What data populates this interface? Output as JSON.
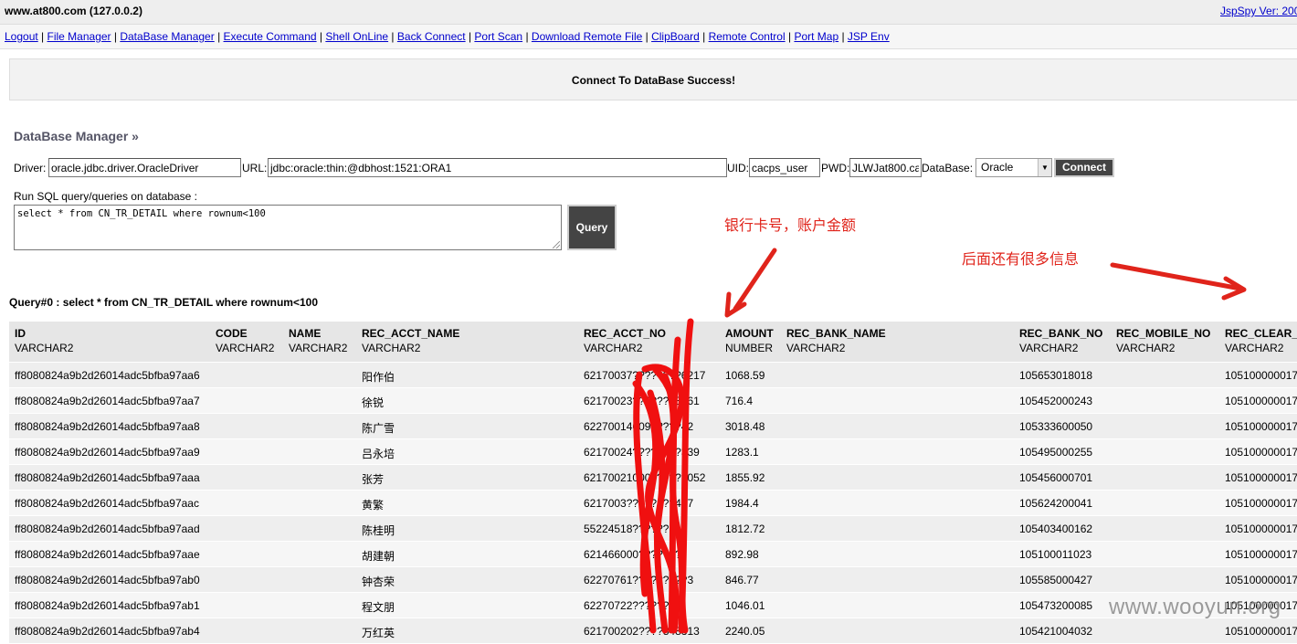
{
  "header": {
    "host": "www.at800.com (127.0.0.2)",
    "version": "JspSpy Ver: 200"
  },
  "nav": [
    "Logout",
    "File Manager",
    "DataBase Manager",
    "Execute Command",
    "Shell OnLine",
    "Back Connect",
    "Port Scan",
    "Download Remote File",
    "ClipBoard",
    "Remote Control",
    "Port Map",
    "JSP Env"
  ],
  "banner": {
    "message": "Connect To DataBase Success!"
  },
  "section_title": "DataBase Manager »",
  "form": {
    "driver_label": "Driver:",
    "driver_value": "oracle.jdbc.driver.OracleDriver",
    "url_label": "URL:",
    "url_value": "jdbc:oracle:thin:@dbhost:1521:ORA1",
    "uid_label": "UID:",
    "uid_value": "cacps_user",
    "pwd_label": "PWD:",
    "pwd_value": "JLWJat800.ca",
    "db_label": "DataBase:",
    "db_selected": "Oracle",
    "connect_label": "Connect"
  },
  "sql": {
    "label": "Run SQL query/queries on database :",
    "value": "select * from CN_TR_DETAIL where rownum<100",
    "button": "Query"
  },
  "query_title": "Query#0 : select * from CN_TR_DETAIL where rownum<100",
  "table": {
    "columns": [
      {
        "name": "ID",
        "type": "VARCHAR2"
      },
      {
        "name": "CODE",
        "type": "VARCHAR2"
      },
      {
        "name": "NAME",
        "type": "VARCHAR2"
      },
      {
        "name": "REC_ACCT_NAME",
        "type": "VARCHAR2"
      },
      {
        "name": "REC_ACCT_NO",
        "type": "VARCHAR2"
      },
      {
        "name": "AMOUNT",
        "type": "NUMBER"
      },
      {
        "name": "REC_BANK_NAME",
        "type": "VARCHAR2"
      },
      {
        "name": "REC_BANK_NO",
        "type": "VARCHAR2"
      },
      {
        "name": "REC_MOBILE_NO",
        "type": "VARCHAR2"
      },
      {
        "name": "REC_CLEAR_",
        "type": "VARCHAR2"
      }
    ],
    "rows": [
      [
        "ff8080824a9b2d26014adc5bfba97aa6",
        "",
        "",
        "阳作伯",
        "62170037????????6217",
        "1068.59",
        "",
        "105653018018",
        "",
        "105100000017"
      ],
      [
        "ff8080824a9b2d26014adc5bfba97aa7",
        "",
        "",
        "徐锐",
        "62170023??????43061",
        "716.4",
        "",
        "105452000243",
        "",
        "105100000017"
      ],
      [
        "ff8080824a9b2d26014adc5bfba97aa8",
        "",
        "",
        "陈广雪",
        "622700146091????42",
        "3018.48",
        "",
        "105333600050",
        "",
        "105100000017"
      ],
      [
        "ff8080824a9b2d26014adc5bfba97aa9",
        "",
        "",
        "吕永培",
        "62170024????????339",
        "1283.1",
        "",
        "105495000255",
        "",
        "105100000017"
      ],
      [
        "ff8080824a9b2d26014adc5bfba97aaa",
        "",
        "",
        "张芳",
        "621700210000?????052",
        "1855.92",
        "",
        "105456000701",
        "",
        "105100000017"
      ],
      [
        "ff8080824a9b2d26014adc5bfba97aac",
        "",
        "",
        "黄繁",
        "6217003????????447",
        "1984.4",
        "",
        "105624200041",
        "",
        "105100000017"
      ],
      [
        "ff8080824a9b2d26014adc5bfba97aad",
        "",
        "",
        "陈桂明",
        "55224518??????",
        "1812.72",
        "",
        "105403400162",
        "",
        "105100000017"
      ],
      [
        "ff8080824a9b2d26014adc5bfba97aae",
        "",
        "",
        "胡建朝",
        "621466000???????",
        "892.98",
        "",
        "105100011023",
        "",
        "105100000017"
      ],
      [
        "ff8080824a9b2d26014adc5bfba97ab0",
        "",
        "",
        "钟杏荣",
        "62270761?????????3",
        "846.77",
        "",
        "105585000427",
        "",
        "105100000017"
      ],
      [
        "ff8080824a9b2d26014adc5bfba97ab1",
        "",
        "",
        "程文朋",
        "62270722???????6",
        "1046.01",
        "",
        "105473200085",
        "",
        "105100000017"
      ],
      [
        "ff8080824a9b2d26014adc5bfba97ab4",
        "",
        "",
        "万红英",
        "621700202????848313",
        "2240.05",
        "",
        "105421004032",
        "",
        "105100000017"
      ]
    ]
  },
  "annotations": {
    "note1": "银行卡号，账户金额",
    "note2": "后面还有很多信息"
  },
  "watermark": "www.wooyun.org",
  "colors": {
    "link": "#0000cc",
    "annotation_red": "#e0241b",
    "button_dark": "#444444",
    "header_bg": "#e6e6e6"
  }
}
